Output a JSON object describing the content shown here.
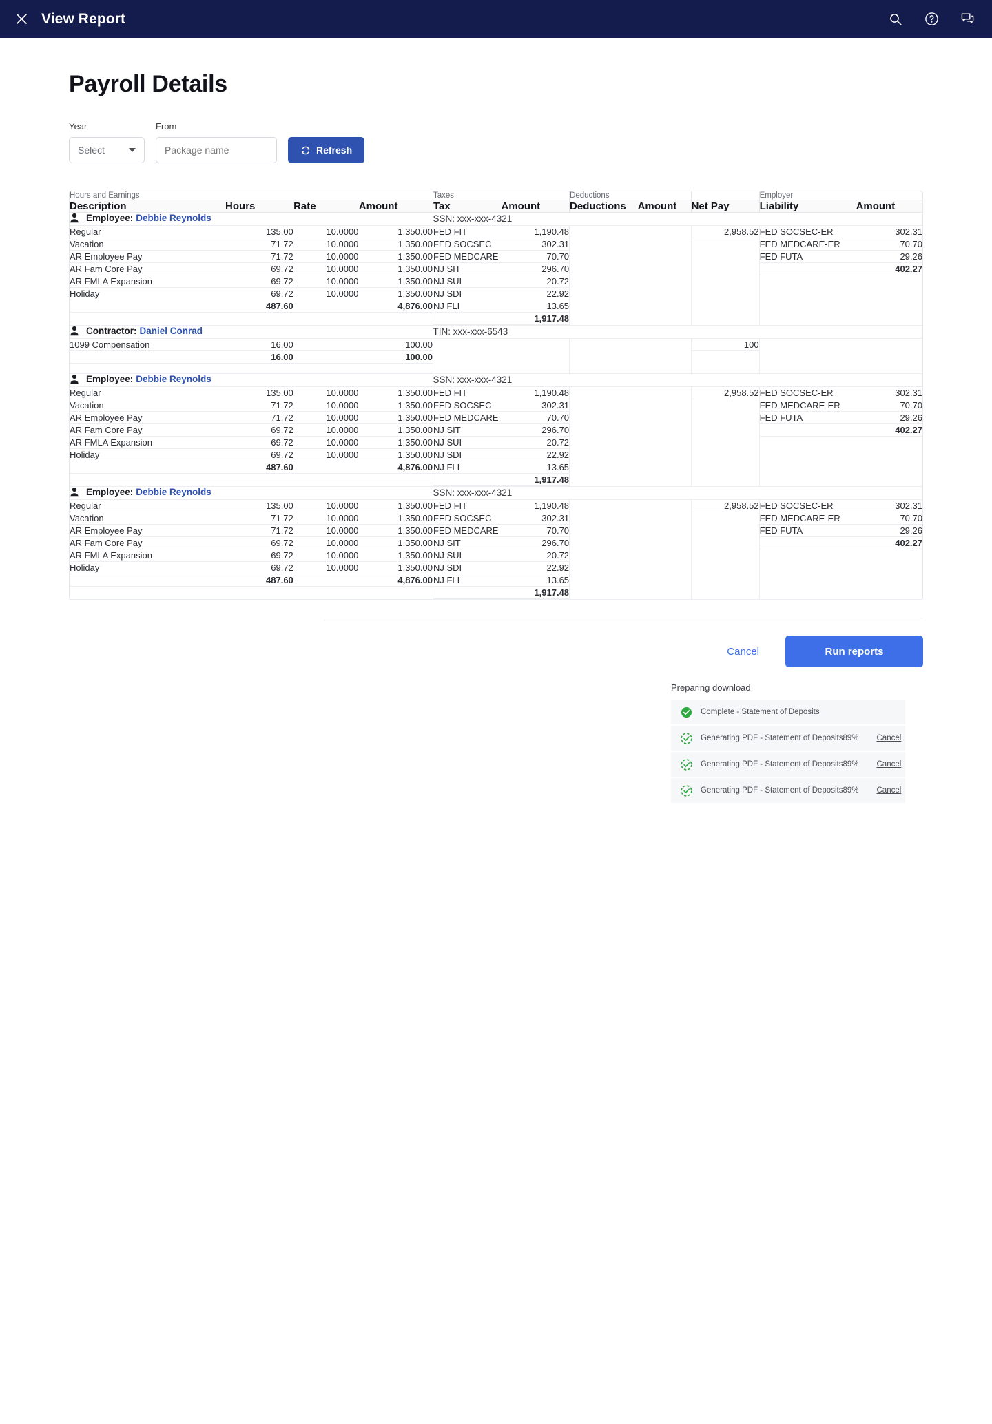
{
  "appbar": {
    "close_icon": "close-icon",
    "title": "View Report",
    "icons": [
      "search-icon",
      "help-icon",
      "chat-icon"
    ]
  },
  "page": {
    "title": "Payroll Details"
  },
  "filters": {
    "year_label": "Year",
    "year_value": "Select",
    "from_label": "From",
    "from_placeholder": "Package name",
    "from_value": "",
    "refresh_label": "Refresh",
    "refresh_icon": "refresh-icon"
  },
  "table": {
    "group_headers": {
      "hours_and_earnings": "Hours and Earnings",
      "taxes": "Taxes",
      "deductions": "Deductions",
      "net_pay": "",
      "employer": "Employer"
    },
    "columns": {
      "description": "Description",
      "hours": "Hours",
      "rate": "Rate",
      "amount": "Amount",
      "tax": "Tax",
      "tax_amount": "Amount",
      "deductions": "Deductions",
      "deductions_amount": "Amount",
      "net_pay": "Net Pay",
      "liability": "Liability",
      "liability_amount": "Amount"
    },
    "sections": [
      {
        "kind": "Employee:",
        "name": "Debbie Reynolds",
        "id_label": "SSN: xxx-xxx-4321",
        "earnings": [
          {
            "description": "Regular",
            "hours": "135.00",
            "rate": "10.0000",
            "amount": "1,350.00"
          },
          {
            "description": "Vacation",
            "hours": "71.72",
            "rate": "10.0000",
            "amount": "1,350.00"
          },
          {
            "description": "AR Employee Pay",
            "hours": "71.72",
            "rate": "10.0000",
            "amount": "1,350.00"
          },
          {
            "description": "AR Fam Core Pay",
            "hours": "69.72",
            "rate": "10.0000",
            "amount": "1,350.00"
          },
          {
            "description": "AR FMLA Expansion",
            "hours": "69.72",
            "rate": "10.0000",
            "amount": "1,350.00"
          },
          {
            "description": "Holiday",
            "hours": "69.72",
            "rate": "10.0000",
            "amount": "1,350.00"
          }
        ],
        "earnings_total": {
          "hours": "487.60",
          "amount": "4,876.00"
        },
        "taxes": [
          {
            "tax": "FED FIT",
            "amount": "1,190.48"
          },
          {
            "tax": "FED SOCSEC",
            "amount": "302.31"
          },
          {
            "tax": "FED MEDCARE",
            "amount": "70.70"
          },
          {
            "tax": "NJ SIT",
            "amount": "296.70"
          },
          {
            "tax": "NJ SUI",
            "amount": "20.72"
          },
          {
            "tax": "NJ SDI",
            "amount": "22.92"
          },
          {
            "tax": "NJ FLI",
            "amount": "13.65"
          }
        ],
        "taxes_total": "1,917.48",
        "deductions": [],
        "net_pay": "2,958.52",
        "employer": [
          {
            "liability": "FED SOCSEC-ER",
            "amount": "302.31"
          },
          {
            "liability": "FED MEDCARE-ER",
            "amount": "70.70"
          },
          {
            "liability": "FED FUTA",
            "amount": "29.26"
          }
        ],
        "employer_total": "402.27"
      },
      {
        "kind": "Contractor:",
        "name": "Daniel Conrad",
        "id_label": "TIN: xxx-xxx-6543",
        "earnings": [
          {
            "description": "1099 Compensation",
            "hours": "16.00",
            "rate": "",
            "amount": "100.00"
          }
        ],
        "earnings_total": {
          "hours": "16.00",
          "amount": "100.00"
        },
        "taxes": [],
        "taxes_total": "",
        "deductions": [],
        "net_pay": "100",
        "employer": [],
        "employer_total": ""
      },
      {
        "kind": "Employee:",
        "name": "Debbie Reynolds",
        "id_label": "SSN: xxx-xxx-4321",
        "earnings": [
          {
            "description": "Regular",
            "hours": "135.00",
            "rate": "10.0000",
            "amount": "1,350.00"
          },
          {
            "description": "Vacation",
            "hours": "71.72",
            "rate": "10.0000",
            "amount": "1,350.00"
          },
          {
            "description": "AR Employee Pay",
            "hours": "71.72",
            "rate": "10.0000",
            "amount": "1,350.00"
          },
          {
            "description": "AR Fam Core Pay",
            "hours": "69.72",
            "rate": "10.0000",
            "amount": "1,350.00"
          },
          {
            "description": "AR FMLA Expansion",
            "hours": "69.72",
            "rate": "10.0000",
            "amount": "1,350.00"
          },
          {
            "description": "Holiday",
            "hours": "69.72",
            "rate": "10.0000",
            "amount": "1,350.00"
          }
        ],
        "earnings_total": {
          "hours": "487.60",
          "amount": "4,876.00"
        },
        "taxes": [
          {
            "tax": "FED FIT",
            "amount": "1,190.48"
          },
          {
            "tax": "FED SOCSEC",
            "amount": "302.31"
          },
          {
            "tax": "FED MEDCARE",
            "amount": "70.70"
          },
          {
            "tax": "NJ SIT",
            "amount": "296.70"
          },
          {
            "tax": "NJ SUI",
            "amount": "20.72"
          },
          {
            "tax": "NJ SDI",
            "amount": "22.92"
          },
          {
            "tax": "NJ FLI",
            "amount": "13.65"
          }
        ],
        "taxes_total": "1,917.48",
        "deductions": [],
        "net_pay": "2,958.52",
        "employer": [
          {
            "liability": "FED SOCSEC-ER",
            "amount": "302.31"
          },
          {
            "liability": "FED MEDCARE-ER",
            "amount": "70.70"
          },
          {
            "liability": "FED FUTA",
            "amount": "29.26"
          }
        ],
        "employer_total": "402.27"
      },
      {
        "kind": "Employee:",
        "name": "Debbie Reynolds",
        "id_label": "SSN: xxx-xxx-4321",
        "earnings": [
          {
            "description": "Regular",
            "hours": "135.00",
            "rate": "10.0000",
            "amount": "1,350.00"
          },
          {
            "description": "Vacation",
            "hours": "71.72",
            "rate": "10.0000",
            "amount": "1,350.00"
          },
          {
            "description": "AR Employee Pay",
            "hours": "71.72",
            "rate": "10.0000",
            "amount": "1,350.00"
          },
          {
            "description": "AR Fam Core Pay",
            "hours": "69.72",
            "rate": "10.0000",
            "amount": "1,350.00"
          },
          {
            "description": "AR FMLA Expansion",
            "hours": "69.72",
            "rate": "10.0000",
            "amount": "1,350.00"
          },
          {
            "description": "Holiday",
            "hours": "69.72",
            "rate": "10.0000",
            "amount": "1,350.00"
          }
        ],
        "earnings_total": {
          "hours": "487.60",
          "amount": "4,876.00"
        },
        "taxes": [
          {
            "tax": "FED FIT",
            "amount": "1,190.48"
          },
          {
            "tax": "FED SOCSEC",
            "amount": "302.31"
          },
          {
            "tax": "FED MEDCARE",
            "amount": "70.70"
          },
          {
            "tax": "NJ SIT",
            "amount": "296.70"
          },
          {
            "tax": "NJ SUI",
            "amount": "20.72"
          },
          {
            "tax": "NJ SDI",
            "amount": "22.92"
          },
          {
            "tax": "NJ FLI",
            "amount": "13.65"
          }
        ],
        "taxes_total": "1,917.48",
        "deductions": [],
        "net_pay": "2,958.52",
        "employer": [
          {
            "liability": "FED SOCSEC-ER",
            "amount": "302.31"
          },
          {
            "liability": "FED MEDCARE-ER",
            "amount": "70.70"
          },
          {
            "liability": "FED FUTA",
            "amount": "29.26"
          }
        ],
        "employer_total": "402.27"
      }
    ]
  },
  "footer": {
    "cancel_label": "Cancel",
    "run_label": "Run reports"
  },
  "downloads": {
    "title": "Preparing download",
    "rows": [
      {
        "icon": "check-circle-filled-icon",
        "label": "Complete - Statement of Deposits",
        "percent": "",
        "cancel": ""
      },
      {
        "icon": "progress-check-icon",
        "label": "Generating PDF - Statement of Deposits",
        "percent": "89%",
        "cancel": "Cancel"
      },
      {
        "icon": "progress-check-icon",
        "label": "Generating PDF - Statement of Deposits",
        "percent": "89%",
        "cancel": "Cancel"
      },
      {
        "icon": "progress-check-icon",
        "label": "Generating PDF - Statement of Deposits",
        "percent": "89%",
        "cancel": "Cancel"
      }
    ]
  },
  "colors": {
    "appbar_bg": "#141b4d",
    "primary_blue": "#2f52b0",
    "action_blue": "#3f6fe8",
    "success_green": "#2eab41"
  }
}
